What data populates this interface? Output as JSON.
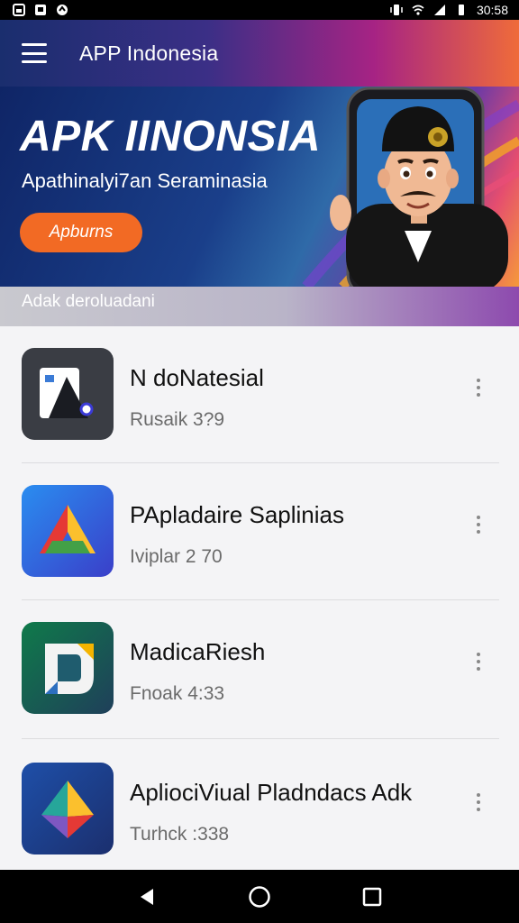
{
  "status_bar": {
    "time": "30:58",
    "left_icons": [
      "gallery-icon",
      "message-icon",
      "sync-icon"
    ],
    "right_icons": [
      "vibrate-icon",
      "wifi-icon",
      "signal-icon",
      "battery-icon"
    ]
  },
  "app_bar": {
    "title": "APP Indonesia",
    "menu_icon": "menu-icon"
  },
  "banner": {
    "headline": "APK IINONSIA",
    "subtitle": "Apathinalyi7an Seraminasia",
    "cta_label": "Apburns"
  },
  "section": {
    "title": "Adak deroluadani"
  },
  "apps": [
    {
      "name": "N doNatesial",
      "meta": "Rusaik 3?9",
      "icon": "white-a-logo-icon"
    },
    {
      "name": "PApladaire Saplinias",
      "meta": "Iviplar 2 70",
      "icon": "colorful-triangle-logo-icon"
    },
    {
      "name": "MadicaRiesh",
      "meta": "Fnoak 4:33",
      "icon": "cube-d-logo-icon"
    },
    {
      "name": "ApliociViual Pladndacs Adk",
      "meta": "Turhck :338",
      "icon": "triangle-gem-logo-icon"
    }
  ],
  "colors": {
    "accent": "#f26a24",
    "app_bar_start": "#1a2e6e",
    "app_bar_end": "#ef6b3a"
  }
}
